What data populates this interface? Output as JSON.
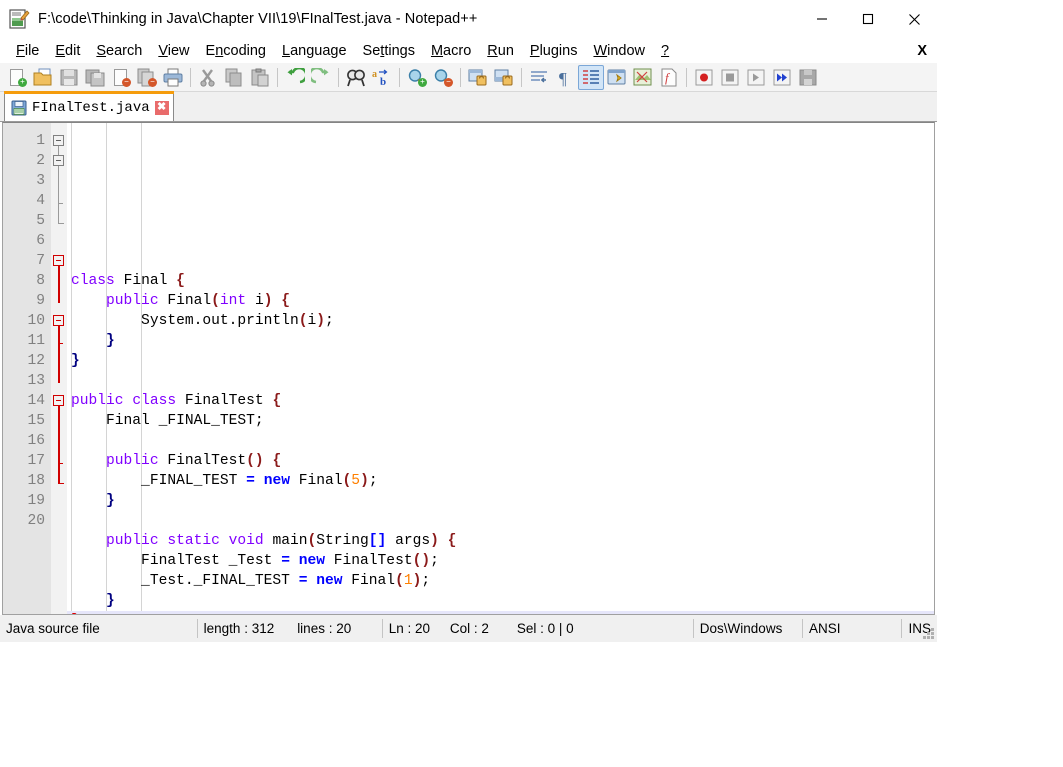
{
  "window": {
    "title": "F:\\code\\Thinking in Java\\Chapter VII\\19\\FInalTest.java - Notepad++",
    "app_icon": "notepad-plus-plus-icon",
    "controls": {
      "minimize": "minimize-icon",
      "maximize": "maximize-icon",
      "close": "close-icon"
    }
  },
  "menubar": {
    "items": [
      {
        "label": "File",
        "accel": "F"
      },
      {
        "label": "Edit",
        "accel": "E"
      },
      {
        "label": "Search",
        "accel": "S"
      },
      {
        "label": "View",
        "accel": "V"
      },
      {
        "label": "Encoding",
        "accel": "n"
      },
      {
        "label": "Language",
        "accel": "L"
      },
      {
        "label": "Settings",
        "accel": "t"
      },
      {
        "label": "Macro",
        "accel": "M"
      },
      {
        "label": "Run",
        "accel": "R"
      },
      {
        "label": "Plugins",
        "accel": "P"
      },
      {
        "label": "Window",
        "accel": "W"
      },
      {
        "label": "?",
        "accel": "?"
      }
    ],
    "close_document": "X"
  },
  "toolbar": {
    "buttons": [
      {
        "name": "new-file-icon",
        "title": "New"
      },
      {
        "name": "open-file-icon",
        "title": "Open"
      },
      {
        "name": "save-icon",
        "title": "Save"
      },
      {
        "name": "save-all-icon",
        "title": "Save All"
      },
      {
        "name": "close-file-icon",
        "title": "Close"
      },
      {
        "name": "close-all-files-icon",
        "title": "Close All"
      },
      {
        "name": "print-icon",
        "title": "Print"
      },
      {
        "name": "cut-icon",
        "title": "Cut"
      },
      {
        "name": "copy-icon",
        "title": "Copy"
      },
      {
        "name": "paste-icon",
        "title": "Paste"
      },
      {
        "name": "undo-icon",
        "title": "Undo"
      },
      {
        "name": "redo-icon",
        "title": "Redo"
      },
      {
        "name": "find-icon",
        "title": "Find"
      },
      {
        "name": "replace-icon",
        "title": "Replace"
      },
      {
        "name": "zoom-in-icon",
        "title": "Zoom In"
      },
      {
        "name": "zoom-out-icon",
        "title": "Zoom Out"
      },
      {
        "name": "sync-vertical-scroll-icon",
        "title": "Synchronize Vertical Scrolling"
      },
      {
        "name": "sync-horizontal-scroll-icon",
        "title": "Synchronize Horizontal Scrolling"
      },
      {
        "name": "word-wrap-icon",
        "title": "Word wrap"
      },
      {
        "name": "show-all-characters-icon",
        "title": "Show All Characters"
      },
      {
        "name": "indent-guide-icon",
        "title": "Show Indent Guide",
        "active": true
      },
      {
        "name": "user-defined-dialog-icon",
        "title": "User Defined Dialogue"
      },
      {
        "name": "document-map-icon",
        "title": "Document Map"
      },
      {
        "name": "function-list-icon",
        "title": "Function List"
      },
      {
        "name": "record-macro-icon",
        "title": "Start Recording"
      },
      {
        "name": "stop-macro-icon",
        "title": "Stop Recording"
      },
      {
        "name": "playback-macro-icon",
        "title": "Playback"
      },
      {
        "name": "run-macro-multiple-icon",
        "title": "Run a Macro Multiple Times"
      },
      {
        "name": "save-macro-icon",
        "title": "Save Currently Recorded Macro"
      }
    ]
  },
  "tabs": [
    {
      "label": "FInalTest.java",
      "icon": "saved-floppy-icon",
      "close": "✖",
      "active": true
    }
  ],
  "editor": {
    "current_line": 20,
    "lines": [
      {
        "n": 1,
        "tokens": []
      },
      {
        "n": 2,
        "tokens": []
      },
      {
        "n": 3,
        "tokens": [
          {
            "t": "class",
            "c": "k"
          },
          {
            "t": " ",
            "c": "id"
          },
          {
            "t": "Final",
            "c": "id"
          },
          {
            "t": " ",
            "c": "id"
          },
          {
            "t": "{",
            "c": "br"
          }
        ]
      },
      {
        "n": 4,
        "tokens": [
          {
            "t": "    ",
            "c": "id"
          },
          {
            "t": "public",
            "c": "k"
          },
          {
            "t": " ",
            "c": "id"
          },
          {
            "t": "Final",
            "c": "id"
          },
          {
            "t": "(",
            "c": "br"
          },
          {
            "t": "int",
            "c": "k"
          },
          {
            "t": " i",
            "c": "id"
          },
          {
            "t": ")",
            "c": "br"
          },
          {
            "t": " ",
            "c": "id"
          },
          {
            "t": "{",
            "c": "br"
          }
        ]
      },
      {
        "n": 5,
        "tokens": [
          {
            "t": "        System.out.println",
            "c": "id"
          },
          {
            "t": "(",
            "c": "br"
          },
          {
            "t": "i",
            "c": "id"
          },
          {
            "t": ")",
            "c": "br"
          },
          {
            "t": ";",
            "c": "id"
          }
        ]
      },
      {
        "n": 6,
        "tokens": [
          {
            "t": "    ",
            "c": "id"
          },
          {
            "t": "}",
            "c": "brn"
          }
        ]
      },
      {
        "n": 7,
        "tokens": [
          {
            "t": "}",
            "c": "brn"
          }
        ]
      },
      {
        "n": 8,
        "tokens": []
      },
      {
        "n": 9,
        "tokens": [
          {
            "t": "public",
            "c": "k"
          },
          {
            "t": " ",
            "c": "id"
          },
          {
            "t": "class",
            "c": "k"
          },
          {
            "t": " ",
            "c": "id"
          },
          {
            "t": "FinalTest",
            "c": "id"
          },
          {
            "t": " ",
            "c": "id"
          },
          {
            "t": "{",
            "c": "br"
          }
        ]
      },
      {
        "n": 10,
        "tokens": [
          {
            "t": "    Final _FINAL_TEST;",
            "c": "id"
          }
        ]
      },
      {
        "n": 11,
        "tokens": []
      },
      {
        "n": 12,
        "tokens": [
          {
            "t": "    ",
            "c": "id"
          },
          {
            "t": "public",
            "c": "k"
          },
          {
            "t": " ",
            "c": "id"
          },
          {
            "t": "FinalTest",
            "c": "id"
          },
          {
            "t": "()",
            "c": "br"
          },
          {
            "t": " ",
            "c": "id"
          },
          {
            "t": "{",
            "c": "br"
          }
        ]
      },
      {
        "n": 13,
        "tokens": [
          {
            "t": "        _FINAL_TEST ",
            "c": "id"
          },
          {
            "t": "=",
            "c": "kb"
          },
          {
            "t": " ",
            "c": "id"
          },
          {
            "t": "new",
            "c": "kb"
          },
          {
            "t": " ",
            "c": "id"
          },
          {
            "t": "Final",
            "c": "id"
          },
          {
            "t": "(",
            "c": "br"
          },
          {
            "t": "5",
            "c": "num"
          },
          {
            "t": ")",
            "c": "br"
          },
          {
            "t": ";",
            "c": "id"
          }
        ]
      },
      {
        "n": 14,
        "tokens": [
          {
            "t": "    ",
            "c": "id"
          },
          {
            "t": "}",
            "c": "brn"
          }
        ]
      },
      {
        "n": 15,
        "tokens": []
      },
      {
        "n": 16,
        "tokens": [
          {
            "t": "    ",
            "c": "id"
          },
          {
            "t": "public",
            "c": "k"
          },
          {
            "t": " ",
            "c": "id"
          },
          {
            "t": "static",
            "c": "k"
          },
          {
            "t": " ",
            "c": "id"
          },
          {
            "t": "void",
            "c": "k"
          },
          {
            "t": " ",
            "c": "id"
          },
          {
            "t": "main",
            "c": "id"
          },
          {
            "t": "(",
            "c": "br"
          },
          {
            "t": "String",
            "c": "id"
          },
          {
            "t": "[]",
            "c": "kb"
          },
          {
            "t": " args",
            "c": "id"
          },
          {
            "t": ")",
            "c": "br"
          },
          {
            "t": " ",
            "c": "id"
          },
          {
            "t": "{",
            "c": "br"
          }
        ]
      },
      {
        "n": 17,
        "tokens": [
          {
            "t": "        FinalTest _Test ",
            "c": "id"
          },
          {
            "t": "=",
            "c": "kb"
          },
          {
            "t": " ",
            "c": "id"
          },
          {
            "t": "new",
            "c": "kb"
          },
          {
            "t": " ",
            "c": "id"
          },
          {
            "t": "FinalTest",
            "c": "id"
          },
          {
            "t": "()",
            "c": "br"
          },
          {
            "t": ";",
            "c": "id"
          }
        ]
      },
      {
        "n": 18,
        "tokens": [
          {
            "t": "        _Test._FINAL_TEST ",
            "c": "id"
          },
          {
            "t": "=",
            "c": "kb"
          },
          {
            "t": " ",
            "c": "id"
          },
          {
            "t": "new",
            "c": "kb"
          },
          {
            "t": " ",
            "c": "id"
          },
          {
            "t": "Final",
            "c": "id"
          },
          {
            "t": "(",
            "c": "br"
          },
          {
            "t": "1",
            "c": "num"
          },
          {
            "t": ")",
            "c": "br"
          },
          {
            "t": ";",
            "c": "id"
          }
        ]
      },
      {
        "n": 19,
        "tokens": [
          {
            "t": "    ",
            "c": "id"
          },
          {
            "t": "}",
            "c": "brn"
          }
        ]
      },
      {
        "n": 20,
        "tokens": [
          {
            "t": "}",
            "c": "brr"
          }
        ]
      }
    ]
  },
  "statusbar": {
    "file_type": "Java source file",
    "length_label": "length : 312",
    "lines_label": "lines : 20",
    "ln_label": "Ln : 20",
    "col_label": "Col : 2",
    "sel_label": "Sel : 0 | 0",
    "eol": "Dos\\Windows",
    "encoding": "ANSI",
    "insert_mode": "INS"
  },
  "colors": {
    "tab_active_bar": "#f59c0c",
    "keyword": "#8000ff",
    "operator": "#0000ff",
    "number": "#ff8000",
    "brace": "#8b1a1a",
    "matched_brace": "#e00000",
    "current_line_bg": "#e6e6fa",
    "fold_active": "#d00000"
  }
}
